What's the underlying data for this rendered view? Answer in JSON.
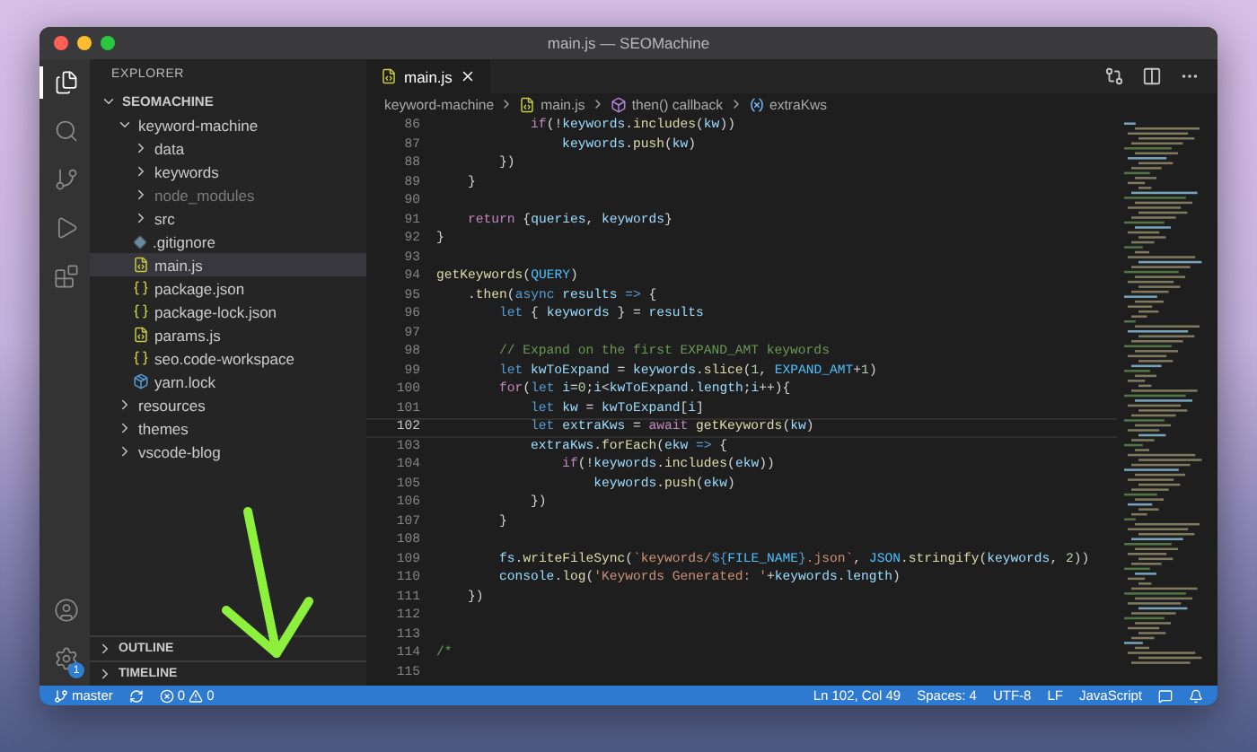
{
  "window": {
    "title": "main.js — SEOMachine"
  },
  "activity_bar": {
    "top": [
      {
        "kind": "files",
        "selected": true
      },
      {
        "kind": "search",
        "selected": false
      },
      {
        "kind": "source-control",
        "selected": false
      },
      {
        "kind": "run",
        "selected": false
      },
      {
        "kind": "extensions",
        "selected": false
      }
    ],
    "bottom": [
      {
        "kind": "account"
      },
      {
        "kind": "settings",
        "badge": "1"
      }
    ]
  },
  "sidebar": {
    "title": "EXPLORER",
    "root": {
      "label": "SEOMACHINE",
      "expanded": true,
      "children": [
        {
          "label": "keyword-machine",
          "kind": "folder",
          "expanded": true,
          "ignored": false,
          "selected": false,
          "children": [
            {
              "label": "data",
              "kind": "folder",
              "expanded": false,
              "ignored": false,
              "selected": false
            },
            {
              "label": "keywords",
              "kind": "folder",
              "expanded": false,
              "ignored": false,
              "selected": false
            },
            {
              "label": "node_modules",
              "kind": "folder",
              "expanded": false,
              "ignored": true,
              "selected": false
            },
            {
              "label": "src",
              "kind": "folder",
              "expanded": false,
              "ignored": false,
              "selected": false
            },
            {
              "label": ".gitignore",
              "kind": "git",
              "ignored": false,
              "selected": false
            },
            {
              "label": "main.js",
              "kind": "js",
              "ignored": false,
              "selected": true
            },
            {
              "label": "package.json",
              "kind": "json",
              "ignored": false,
              "selected": false
            },
            {
              "label": "package-lock.json",
              "kind": "json",
              "ignored": false,
              "selected": false
            },
            {
              "label": "params.js",
              "kind": "js",
              "ignored": false,
              "selected": false
            },
            {
              "label": "seo.code-workspace",
              "kind": "json",
              "ignored": false,
              "selected": false
            },
            {
              "label": "yarn.lock",
              "kind": "yarn",
              "ignored": false,
              "selected": false
            }
          ]
        },
        {
          "label": "resources",
          "kind": "folder",
          "expanded": false,
          "ignored": false,
          "selected": false
        },
        {
          "label": "themes",
          "kind": "folder",
          "expanded": false,
          "ignored": false,
          "selected": false
        },
        {
          "label": "vscode-blog",
          "kind": "folder",
          "expanded": false,
          "ignored": false,
          "selected": false
        }
      ]
    },
    "panels": [
      {
        "label": "OUTLINE",
        "expanded": false
      },
      {
        "label": "TIMELINE",
        "expanded": false
      }
    ]
  },
  "tabs": [
    {
      "label": "main.js",
      "selected": true
    }
  ],
  "breadcrumbs": [
    {
      "label": "keyword-machine",
      "kind": "folder"
    },
    {
      "label": "main.js",
      "kind": "js"
    },
    {
      "label": "then() callback",
      "kind": "method"
    },
    {
      "label": "extraKws",
      "kind": "variable"
    }
  ],
  "code": [
    {
      "number": "86",
      "current": false,
      "tokens": [
        {
          "text": "            if",
          "kind": "control"
        },
        {
          "text": "(!",
          "kind": "plain"
        },
        {
          "text": "keywords",
          "kind": "var"
        },
        {
          "text": ".",
          "kind": "plain"
        },
        {
          "text": "includes",
          "kind": "fn"
        },
        {
          "text": "(",
          "kind": "plain"
        },
        {
          "text": "kw",
          "kind": "var"
        },
        {
          "text": "))",
          "kind": "plain"
        }
      ]
    },
    {
      "number": "87",
      "current": false,
      "tokens": [
        {
          "text": "                keywords",
          "kind": "var"
        },
        {
          "text": ".",
          "kind": "plain"
        },
        {
          "text": "push",
          "kind": "fn"
        },
        {
          "text": "(",
          "kind": "plain"
        },
        {
          "text": "kw",
          "kind": "var"
        },
        {
          "text": ")",
          "kind": "plain"
        }
      ]
    },
    {
      "number": "88",
      "current": false,
      "tokens": [
        {
          "text": "        })",
          "kind": "plain"
        }
      ]
    },
    {
      "number": "89",
      "current": false,
      "tokens": [
        {
          "text": "    }",
          "kind": "plain"
        }
      ]
    },
    {
      "number": "90",
      "current": false
    },
    {
      "number": "91",
      "current": false,
      "tokens": [
        {
          "text": "    return",
          "kind": "control"
        },
        {
          "text": " {",
          "kind": "plain"
        },
        {
          "text": "queries",
          "kind": "var"
        },
        {
          "text": ", ",
          "kind": "plain"
        },
        {
          "text": "keywords",
          "kind": "var"
        },
        {
          "text": "}",
          "kind": "plain"
        }
      ]
    },
    {
      "number": "92",
      "current": false,
      "tokens": [
        {
          "text": "}",
          "kind": "plain"
        }
      ]
    },
    {
      "number": "93",
      "current": false
    },
    {
      "number": "94",
      "current": false,
      "tokens": [
        {
          "text": "getKeywords",
          "kind": "fn"
        },
        {
          "text": "(",
          "kind": "plain"
        },
        {
          "text": "QUERY",
          "kind": "const"
        },
        {
          "text": ")",
          "kind": "plain"
        }
      ]
    },
    {
      "number": "95",
      "current": false,
      "tokens": [
        {
          "text": "    .",
          "kind": "plain"
        },
        {
          "text": "then",
          "kind": "fn"
        },
        {
          "text": "(",
          "kind": "plain"
        },
        {
          "text": "async ",
          "kind": "keyword"
        },
        {
          "text": "results ",
          "kind": "var"
        },
        {
          "text": "=>",
          "kind": "keyword"
        },
        {
          "text": " {",
          "kind": "plain"
        }
      ]
    },
    {
      "number": "96",
      "current": false,
      "tokens": [
        {
          "text": "        let",
          "kind": "keyword"
        },
        {
          "text": " { ",
          "kind": "plain"
        },
        {
          "text": "keywords",
          "kind": "var"
        },
        {
          "text": " } = ",
          "kind": "plain"
        },
        {
          "text": "results",
          "kind": "var"
        }
      ]
    },
    {
      "number": "97",
      "current": false
    },
    {
      "number": "98",
      "current": false,
      "tokens": [
        {
          "text": "        // Expand on the first EXPAND_AMT keywords",
          "kind": "comment"
        }
      ]
    },
    {
      "number": "99",
      "current": false,
      "tokens": [
        {
          "text": "        let ",
          "kind": "keyword"
        },
        {
          "text": "kwToExpand",
          "kind": "var"
        },
        {
          "text": " = ",
          "kind": "plain"
        },
        {
          "text": "keywords",
          "kind": "var"
        },
        {
          "text": ".",
          "kind": "plain"
        },
        {
          "text": "slice",
          "kind": "fn"
        },
        {
          "text": "(",
          "kind": "plain"
        },
        {
          "text": "1",
          "kind": "number"
        },
        {
          "text": ", ",
          "kind": "plain"
        },
        {
          "text": "EXPAND_AMT",
          "kind": "const"
        },
        {
          "text": "+",
          "kind": "plain"
        },
        {
          "text": "1",
          "kind": "number"
        },
        {
          "text": ")",
          "kind": "plain"
        }
      ]
    },
    {
      "number": "100",
      "current": false,
      "tokens": [
        {
          "text": "        for",
          "kind": "control"
        },
        {
          "text": "(",
          "kind": "plain"
        },
        {
          "text": "let ",
          "kind": "keyword"
        },
        {
          "text": "i",
          "kind": "var"
        },
        {
          "text": "=",
          "kind": "plain"
        },
        {
          "text": "0",
          "kind": "number"
        },
        {
          "text": ";",
          "kind": "plain"
        },
        {
          "text": "i",
          "kind": "var"
        },
        {
          "text": "<",
          "kind": "plain"
        },
        {
          "text": "kwToExpand",
          "kind": "var"
        },
        {
          "text": ".",
          "kind": "plain"
        },
        {
          "text": "length",
          "kind": "var"
        },
        {
          "text": ";",
          "kind": "plain"
        },
        {
          "text": "i",
          "kind": "var"
        },
        {
          "text": "++){",
          "kind": "plain"
        }
      ]
    },
    {
      "number": "101",
      "current": false,
      "tokens": [
        {
          "text": "            let ",
          "kind": "keyword"
        },
        {
          "text": "kw",
          "kind": "var"
        },
        {
          "text": " = ",
          "kind": "plain"
        },
        {
          "text": "kwToExpand",
          "kind": "var"
        },
        {
          "text": "[",
          "kind": "plain"
        },
        {
          "text": "i",
          "kind": "var"
        },
        {
          "text": "]",
          "kind": "plain"
        }
      ]
    },
    {
      "number": "102",
      "current": true,
      "tokens": [
        {
          "text": "            let ",
          "kind": "keyword"
        },
        {
          "text": "extraKws",
          "kind": "var"
        },
        {
          "text": " = ",
          "kind": "plain"
        },
        {
          "text": "await ",
          "kind": "control"
        },
        {
          "text": "getKeywords",
          "kind": "fn"
        },
        {
          "text": "(",
          "kind": "plain"
        },
        {
          "text": "kw",
          "kind": "var"
        },
        {
          "text": ")",
          "kind": "plain"
        }
      ]
    },
    {
      "number": "103",
      "current": false,
      "tokens": [
        {
          "text": "            extraKws",
          "kind": "var"
        },
        {
          "text": ".",
          "kind": "plain"
        },
        {
          "text": "forEach",
          "kind": "fn"
        },
        {
          "text": "(",
          "kind": "plain"
        },
        {
          "text": "ekw ",
          "kind": "var"
        },
        {
          "text": "=>",
          "kind": "keyword"
        },
        {
          "text": " {",
          "kind": "plain"
        }
      ]
    },
    {
      "number": "104",
      "current": false,
      "tokens": [
        {
          "text": "                if",
          "kind": "control"
        },
        {
          "text": "(!",
          "kind": "plain"
        },
        {
          "text": "keywords",
          "kind": "var"
        },
        {
          "text": ".",
          "kind": "plain"
        },
        {
          "text": "includes",
          "kind": "fn"
        },
        {
          "text": "(",
          "kind": "plain"
        },
        {
          "text": "ekw",
          "kind": "var"
        },
        {
          "text": "))",
          "kind": "plain"
        }
      ]
    },
    {
      "number": "105",
      "current": false,
      "tokens": [
        {
          "text": "                    keywords",
          "kind": "var"
        },
        {
          "text": ".",
          "kind": "plain"
        },
        {
          "text": "push",
          "kind": "fn"
        },
        {
          "text": "(",
          "kind": "plain"
        },
        {
          "text": "ekw",
          "kind": "var"
        },
        {
          "text": ")",
          "kind": "plain"
        }
      ]
    },
    {
      "number": "106",
      "current": false,
      "tokens": [
        {
          "text": "            })",
          "kind": "plain"
        }
      ]
    },
    {
      "number": "107",
      "current": false,
      "tokens": [
        {
          "text": "        }",
          "kind": "plain"
        }
      ]
    },
    {
      "number": "108",
      "current": false
    },
    {
      "number": "109",
      "current": false,
      "tokens": [
        {
          "text": "        fs",
          "kind": "var"
        },
        {
          "text": ".",
          "kind": "plain"
        },
        {
          "text": "writeFileSync",
          "kind": "fn"
        },
        {
          "text": "(",
          "kind": "plain"
        },
        {
          "text": "`keywords/",
          "kind": "string"
        },
        {
          "text": "${",
          "kind": "keyword"
        },
        {
          "text": "FILE_NAME",
          "kind": "const"
        },
        {
          "text": "}",
          "kind": "keyword"
        },
        {
          "text": ".json`",
          "kind": "string"
        },
        {
          "text": ", ",
          "kind": "plain"
        },
        {
          "text": "JSON",
          "kind": "const"
        },
        {
          "text": ".",
          "kind": "plain"
        },
        {
          "text": "stringify",
          "kind": "fn"
        },
        {
          "text": "(",
          "kind": "plain"
        },
        {
          "text": "keywords",
          "kind": "var"
        },
        {
          "text": ", ",
          "kind": "plain"
        },
        {
          "text": "2",
          "kind": "number"
        },
        {
          "text": "))",
          "kind": "plain"
        }
      ]
    },
    {
      "number": "110",
      "current": false,
      "tokens": [
        {
          "text": "        console",
          "kind": "var"
        },
        {
          "text": ".",
          "kind": "plain"
        },
        {
          "text": "log",
          "kind": "fn"
        },
        {
          "text": "(",
          "kind": "plain"
        },
        {
          "text": "'Keywords Generated: '",
          "kind": "string"
        },
        {
          "text": "+",
          "kind": "plain"
        },
        {
          "text": "keywords",
          "kind": "var"
        },
        {
          "text": ".",
          "kind": "plain"
        },
        {
          "text": "length",
          "kind": "var"
        },
        {
          "text": ")",
          "kind": "plain"
        }
      ]
    },
    {
      "number": "111",
      "current": false,
      "tokens": [
        {
          "text": "    })",
          "kind": "plain"
        }
      ]
    },
    {
      "number": "112",
      "current": false
    },
    {
      "number": "113",
      "current": false
    },
    {
      "number": "114",
      "current": false,
      "tokens": [
        {
          "text": "/*",
          "kind": "comment"
        }
      ]
    },
    {
      "number": "115",
      "current": false
    }
  ],
  "status_bar": {
    "branch": "master",
    "errors": "0",
    "warnings": "0",
    "right": [
      "Ln 102, Col 49",
      "Spaces: 4",
      "UTF-8",
      "LF",
      "JavaScript"
    ]
  }
}
